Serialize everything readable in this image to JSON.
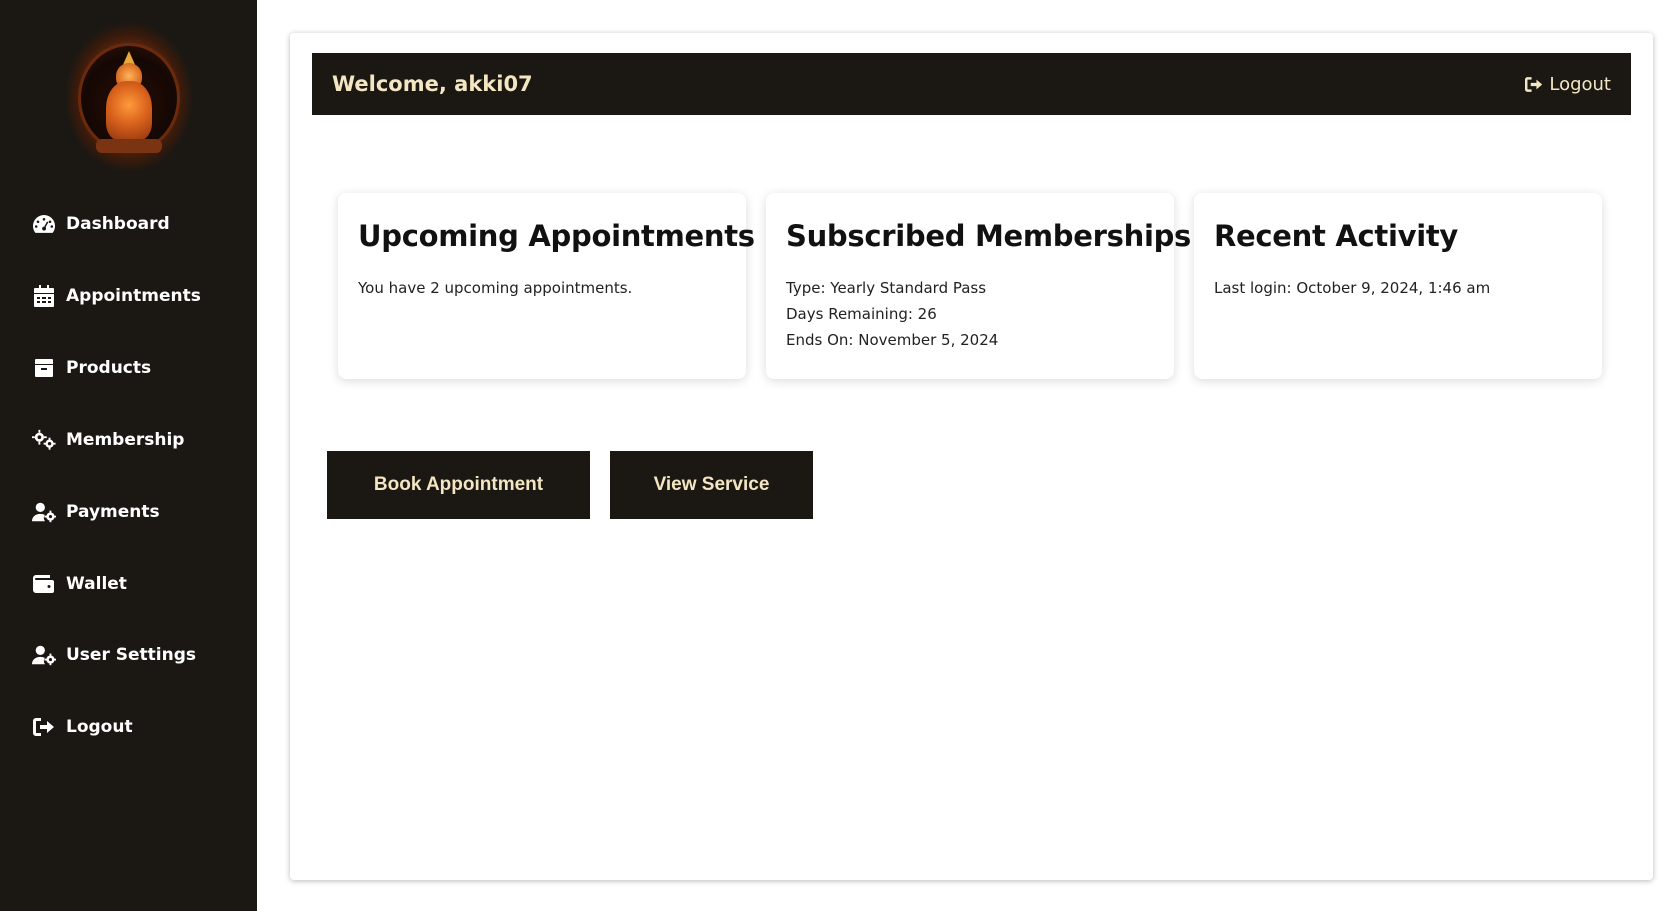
{
  "sidebar": {
    "logo_icon": "ganesha-logo",
    "items": [
      {
        "label": "Dashboard",
        "icon": "gauge-icon"
      },
      {
        "label": "Appointments",
        "icon": "calendar-icon"
      },
      {
        "label": "Products",
        "icon": "box-icon"
      },
      {
        "label": "Membership",
        "icon": "gears-icon"
      },
      {
        "label": "Payments",
        "icon": "user-gear-icon"
      },
      {
        "label": "Wallet",
        "icon": "wallet-icon"
      },
      {
        "label": "User Settings",
        "icon": "user-gear-icon"
      },
      {
        "label": "Logout",
        "icon": "logout-icon"
      }
    ]
  },
  "header": {
    "welcome": "Welcome, akki07",
    "logout_label": "Logout"
  },
  "cards": {
    "appointments": {
      "title": "Upcoming Appointments",
      "text": "You have 2 upcoming appointments."
    },
    "memberships": {
      "title": "Subscribed Memberships",
      "type": "Type: Yearly Standard Pass",
      "days": "Days Remaining: 26",
      "ends": "Ends On: November 5, 2024"
    },
    "activity": {
      "title": "Recent Activity",
      "last_login": "Last login: October 9, 2024, 1:46 am"
    }
  },
  "actions": {
    "book_label": "Book Appointment",
    "view_label": "View Service"
  },
  "colors": {
    "sidebar_bg": "#1b1813",
    "accent_text": "#f4e6c3",
    "panel_bg": "#ffffff"
  }
}
